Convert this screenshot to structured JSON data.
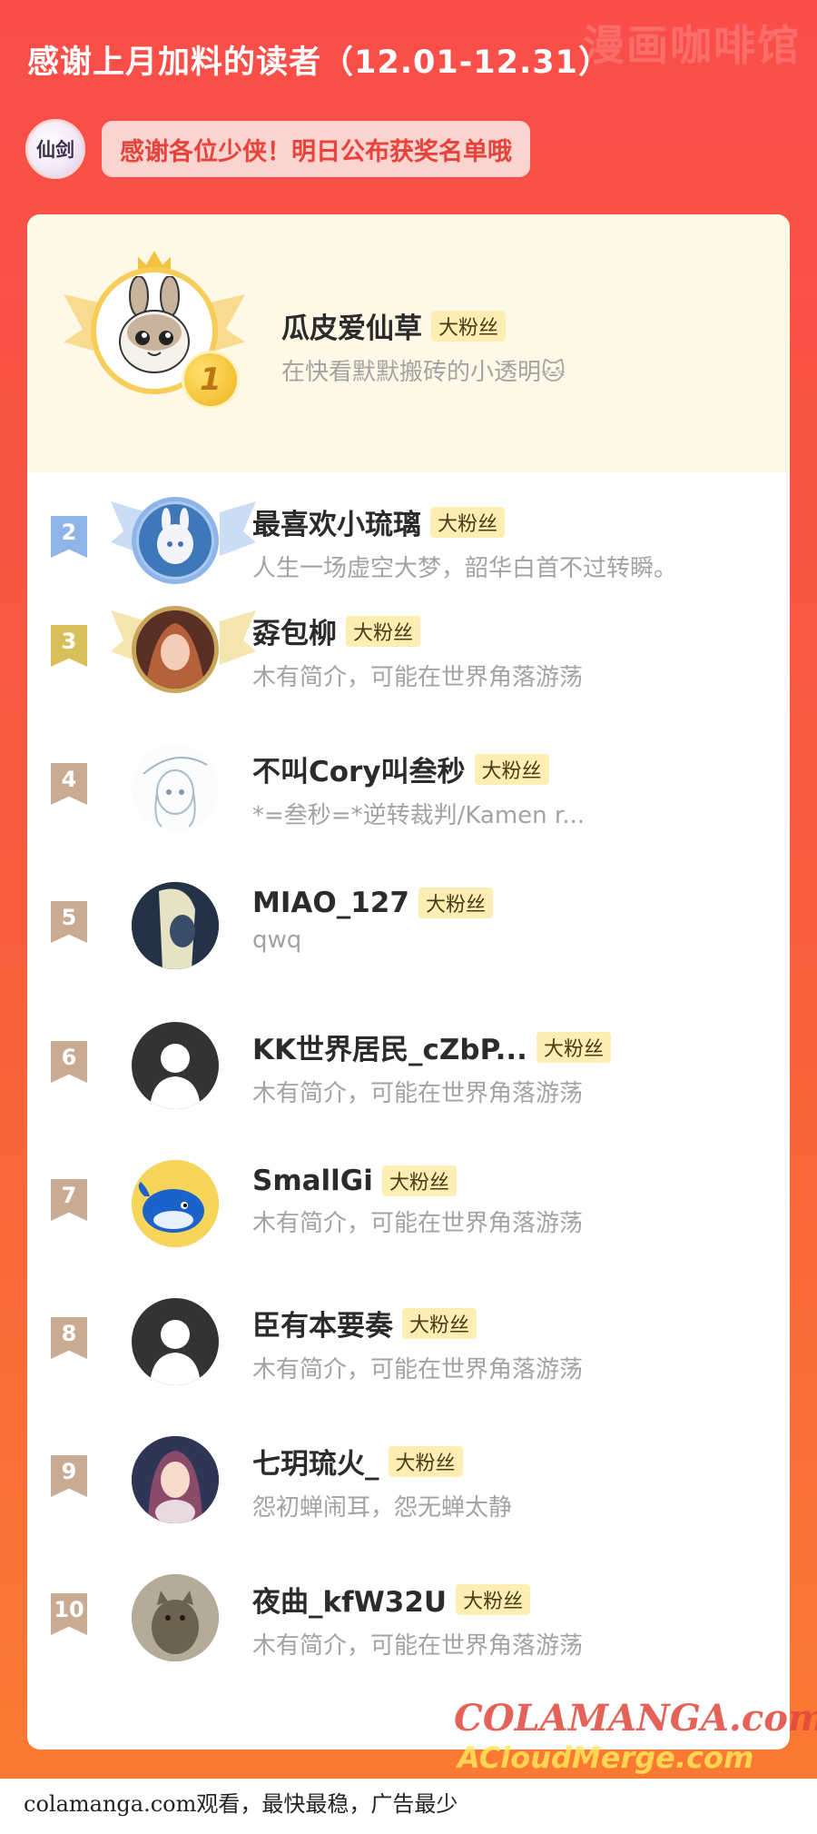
{
  "header": {
    "watermark": "漫画咖啡馆",
    "title": "感谢上月加料的读者（12.01-12.31）",
    "logo_text": "仙剑",
    "notice": "感谢各位少侠！明日公布获奖名单哦"
  },
  "top_fan": {
    "rank": "1",
    "name": "瓜皮爱仙草",
    "badge": "大粉丝",
    "bio": "在快看默默搬砖的小透明🐱"
  },
  "fans": [
    {
      "rank": "2",
      "name": "最喜欢小琉璃",
      "badge": "大粉丝",
      "bio": "人生一场虚空大梦，韶华白首不过转瞬。"
    },
    {
      "rank": "3",
      "name": "孬包柳",
      "badge": "大粉丝",
      "bio": "木有简介，可能在世界角落游荡"
    },
    {
      "rank": "4",
      "name": "不叫Cory叫叁秒",
      "badge": "大粉丝",
      "bio": "*=叁秒=*逆转裁判/Kamen r..."
    },
    {
      "rank": "5",
      "name": "MIAO_127",
      "badge": "大粉丝",
      "bio": "qwq"
    },
    {
      "rank": "6",
      "name": "KK世界居民_cZbP...",
      "badge": "大粉丝",
      "bio": "木有简介，可能在世界角落游荡"
    },
    {
      "rank": "7",
      "name": "SmallGi",
      "badge": "大粉丝",
      "bio": "木有简介，可能在世界角落游荡"
    },
    {
      "rank": "8",
      "name": "臣有本要奏",
      "badge": "大粉丝",
      "bio": "木有简介，可能在世界角落游荡"
    },
    {
      "rank": "9",
      "name": "七玥琉火_",
      "badge": "大粉丝",
      "bio": "怨初蝉闹耳，怨无蝉太静"
    },
    {
      "rank": "10",
      "name": "夜曲_kfW32U",
      "badge": "大粉丝",
      "bio": "木有简介，可能在世界角落游荡"
    }
  ],
  "watermarks": {
    "cola": "COLAMANGA.com",
    "cloud": "ACloudMerge.com"
  },
  "footer": {
    "text": "colamanga.com观看，最快最稳，广告最少"
  },
  "colors": {
    "rank2_flag": "#8fb5e8",
    "rank3_flag": "#d9bf5a",
    "other_flag": "#c9ab93",
    "badge_bg": "#fdeeb3"
  }
}
